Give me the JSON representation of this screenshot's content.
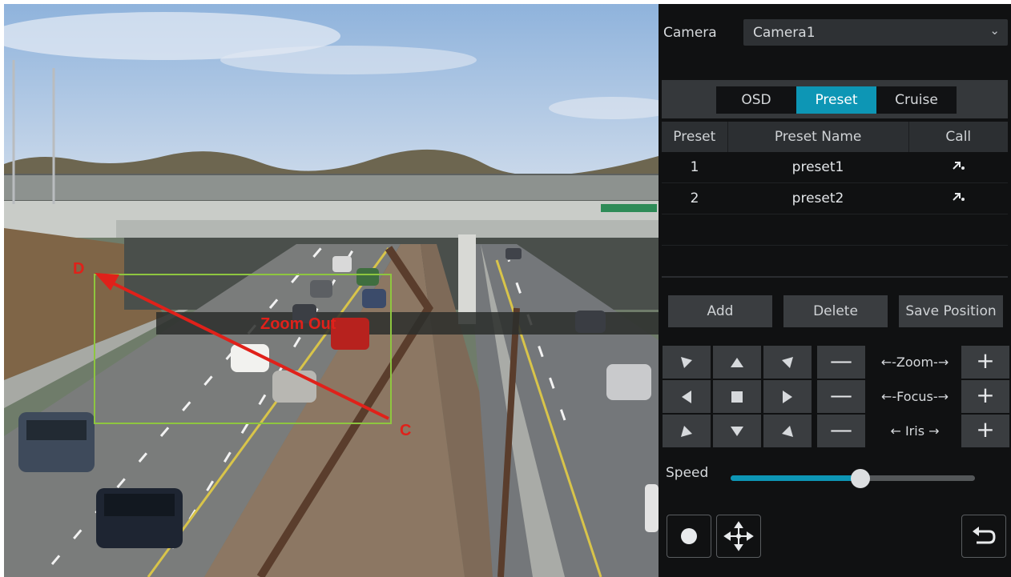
{
  "video": {
    "overlay": {
      "label_d": "D",
      "label_c": "C",
      "zoom_text": "Zoom Out"
    },
    "colors": {
      "zoom_box": "#8ec63f",
      "arrow": "#e0211a"
    }
  },
  "panel": {
    "camera_label": "Camera",
    "camera_value": "Camera1",
    "tabs": [
      {
        "label": "OSD",
        "active": false
      },
      {
        "label": "Preset",
        "active": true
      },
      {
        "label": "Cruise",
        "active": false
      }
    ],
    "table": {
      "headers": [
        "Preset",
        "Preset Name",
        "Call"
      ],
      "rows": [
        {
          "num": "1",
          "name": "preset1",
          "call_icon": "call-preset-icon"
        },
        {
          "num": "2",
          "name": "preset2",
          "call_icon": "call-preset-icon"
        }
      ]
    },
    "buttons": {
      "add": "Add",
      "delete": "Delete",
      "save_position": "Save Position"
    },
    "lens": {
      "zoom": "←-Zoom-→",
      "focus": "←-Focus-→",
      "iris": "← Iris →",
      "minus": "—",
      "plus": "+"
    },
    "speed": {
      "label": "Speed",
      "level": 0.53
    },
    "accent_color": "#0d96b5"
  }
}
